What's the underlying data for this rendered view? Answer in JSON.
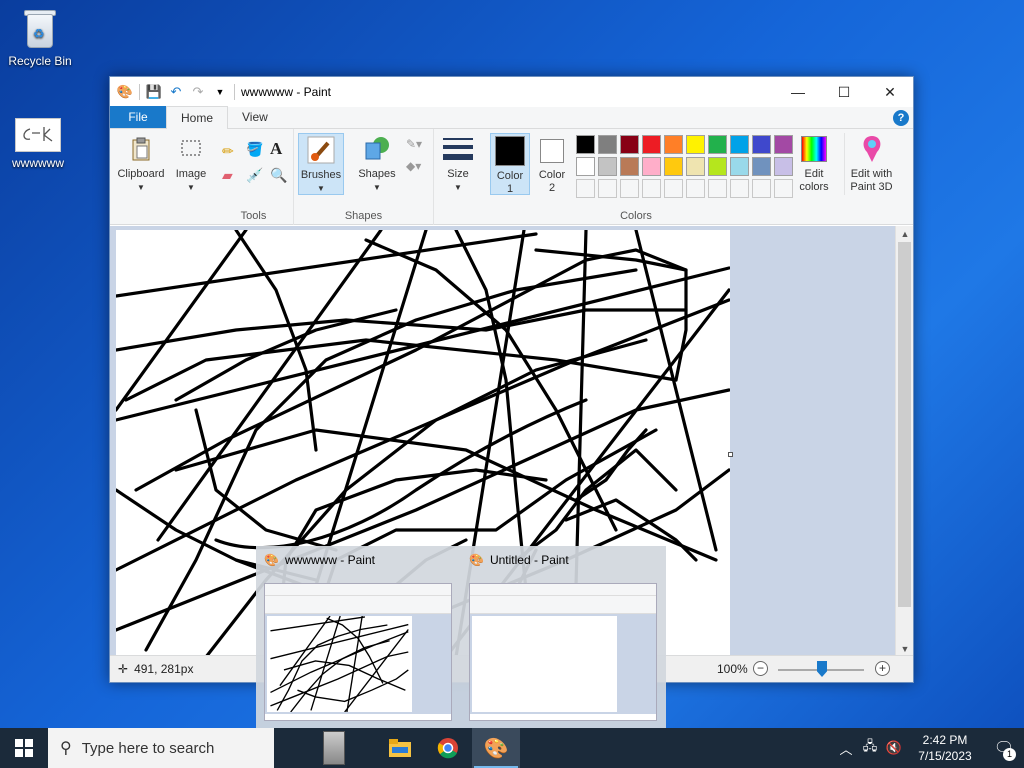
{
  "desktop": {
    "icons": [
      {
        "label": "Recycle Bin"
      },
      {
        "label": "wwwwww"
      }
    ]
  },
  "window": {
    "title": "wwwwww - Paint",
    "tabs": {
      "file": "File",
      "home": "Home",
      "view": "View"
    },
    "help": "?",
    "ribbon": {
      "clipboard": "Clipboard",
      "image": "Image",
      "tools_group": "Tools",
      "brushes": "Brushes",
      "shapes": "Shapes",
      "shapes_group": "Shapes",
      "size": "Size",
      "color1_line1": "Color",
      "color1_line2": "1",
      "color2_line1": "Color",
      "color2_line2": "2",
      "colors_group": "Colors",
      "edit_colors_line1": "Edit",
      "edit_colors_line2": "colors",
      "edit3d_line1": "Edit with",
      "edit3d_line2": "Paint 3D",
      "palette_row1": [
        "#000000",
        "#7f7f7f",
        "#880015",
        "#ed1c24",
        "#ff7f27",
        "#fff200",
        "#22b14c",
        "#00a2e8",
        "#3f48cc",
        "#a349a4"
      ],
      "palette_row2": [
        "#ffffff",
        "#c3c3c3",
        "#b97a57",
        "#ffaec9",
        "#ffc90e",
        "#efe4b0",
        "#b5e61d",
        "#99d9ea",
        "#7092be",
        "#c8bfe7"
      ],
      "color1": "#000000",
      "color2": "#ffffff"
    },
    "status": {
      "position": "491, 281px",
      "zoom": "100%",
      "zoom_minus": "−",
      "zoom_plus": "+"
    }
  },
  "thumbnails": [
    {
      "title": "wwwwww - Paint"
    },
    {
      "title": "Untitled - Paint"
    }
  ],
  "taskbar": {
    "search_placeholder": "Type here to search",
    "time": "2:42 PM",
    "date": "7/15/2023",
    "notif_count": "1"
  }
}
